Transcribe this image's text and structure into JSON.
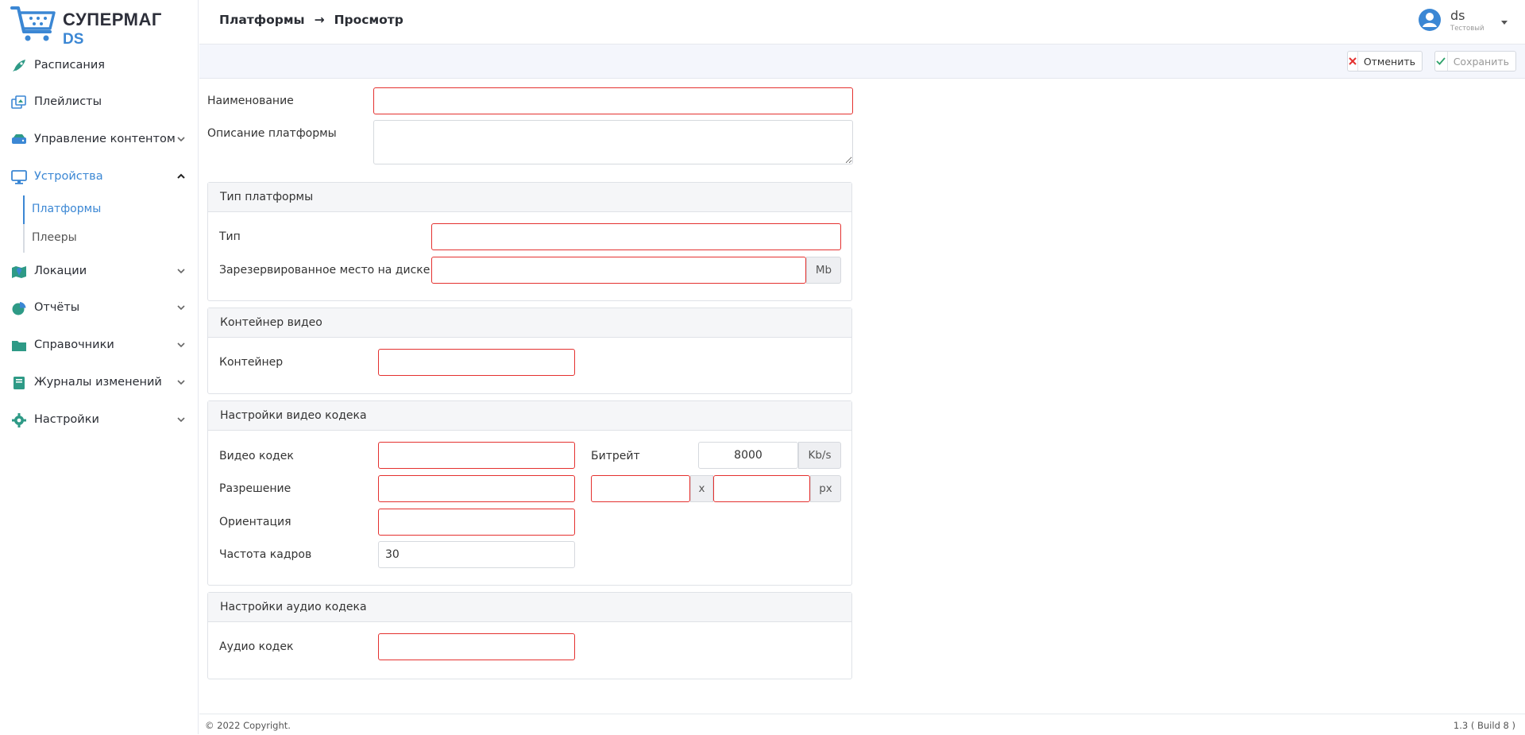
{
  "brand": {
    "line1": "СУПЕРМАГ",
    "line2": "DS"
  },
  "sidebar": {
    "items": [
      {
        "label": "Расписания",
        "icon": "rocket-icon"
      },
      {
        "label": "Плейлисты",
        "icon": "playlist-icon"
      },
      {
        "label": "Управление контентом",
        "icon": "server-icon"
      },
      {
        "label": "Устройства",
        "icon": "monitor-icon"
      },
      {
        "label": "Локации",
        "icon": "map-icon"
      },
      {
        "label": "Отчёты",
        "icon": "pie-chart-icon"
      },
      {
        "label": "Справочники",
        "icon": "folder-icon"
      },
      {
        "label": "Журналы изменений",
        "icon": "book-icon"
      },
      {
        "label": "Настройки",
        "icon": "gear-icon"
      }
    ],
    "subitems": [
      {
        "label": "Платформы"
      },
      {
        "label": "Плееры"
      }
    ]
  },
  "breadcrumb": {
    "section": "Платформы",
    "arrow": "→",
    "page": "Просмотр"
  },
  "user": {
    "name": "ds",
    "role": "Тестовый"
  },
  "toolbar": {
    "cancel_label": "Отменить",
    "save_label": "Сохранить"
  },
  "form": {
    "name_label": "Наименование",
    "name_value": "",
    "description_label": "Описание платформы",
    "description_value": ""
  },
  "platform_type": {
    "title": "Тип платформы",
    "type_label": "Тип",
    "type_value": "",
    "disk_label": "Зарезервированное место на диске",
    "disk_value": "",
    "disk_unit": "Mb"
  },
  "video_container": {
    "title": "Контейнер видео",
    "container_label": "Контейнер",
    "container_value": ""
  },
  "video_codec": {
    "title": "Настройки видео кодека",
    "codec_label": "Видео кодек",
    "codec_value": "",
    "bitrate_label": "Битрейт",
    "bitrate_value": "8000",
    "bitrate_unit": "Kb/s",
    "resolution_label": "Разрешение",
    "resolution_value": "",
    "width_value": "",
    "times": "x",
    "height_value": "",
    "resolution_unit": "px",
    "orientation_label": "Ориентация",
    "orientation_value": "",
    "framerate_label": "Частота кадров",
    "framerate_value": "30"
  },
  "audio_codec": {
    "title": "Настройки аудио кодека",
    "codec_label": "Аудио кодек",
    "codec_value": ""
  },
  "footer": {
    "copyright": "© 2022 Copyright.",
    "version": "1.3 ( Build 8 )"
  },
  "colors": {
    "accent": "#3b87d4",
    "error": "#e4312f",
    "icon": "#2e9a86"
  }
}
